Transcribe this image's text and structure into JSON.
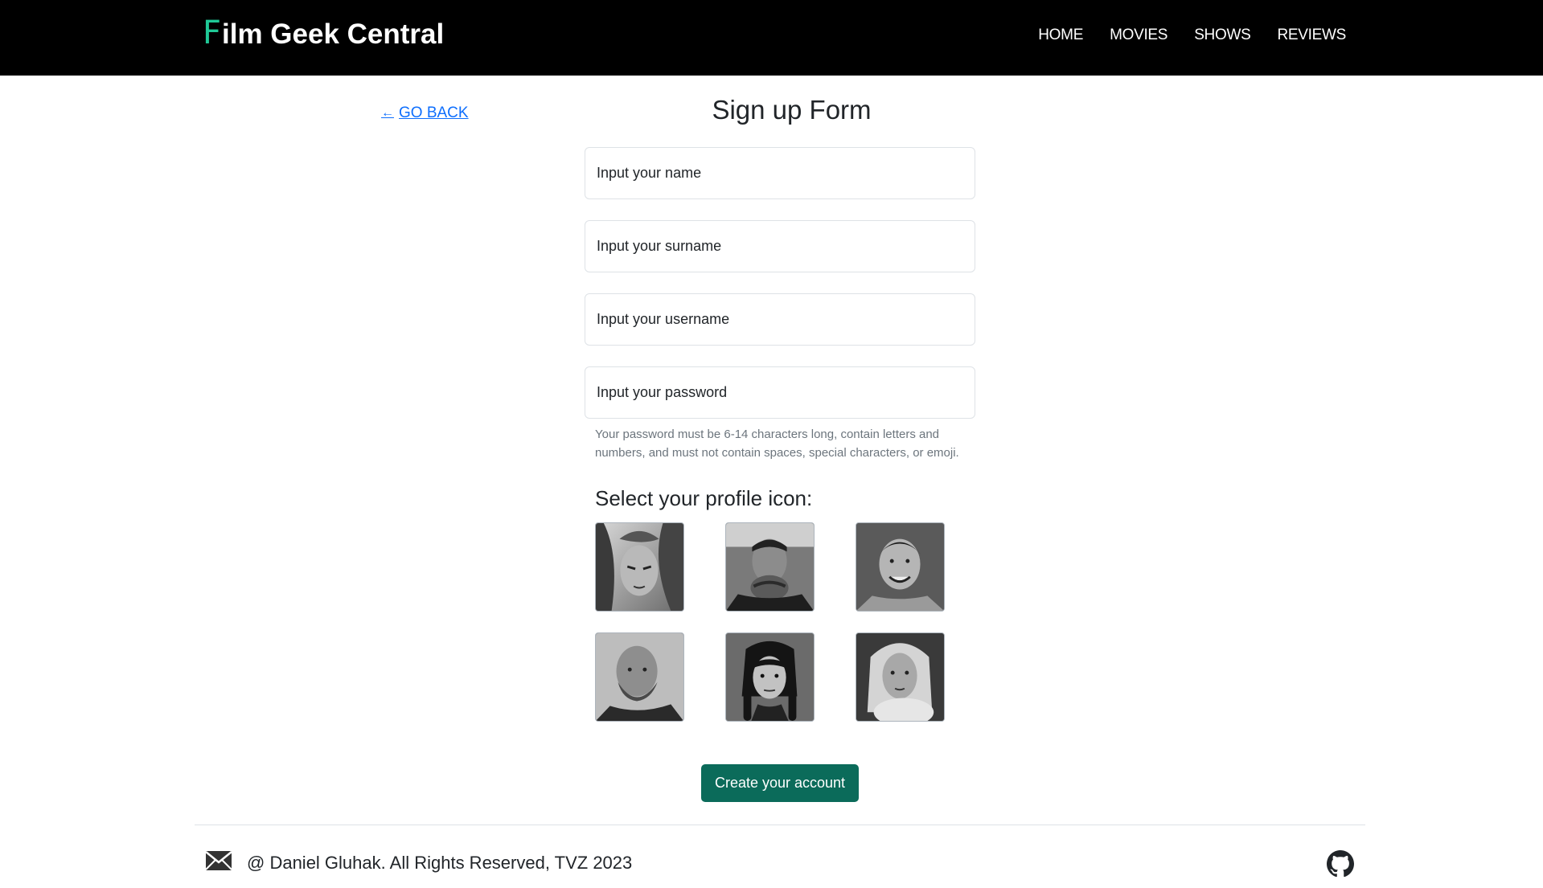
{
  "navbar": {
    "brand_first_letter": "F",
    "brand_rest": "ilm Geek Central",
    "links": [
      "HOME",
      "MOVIES",
      "SHOWS",
      "REVIEWS"
    ],
    "accent_color": "#20c997",
    "background": "#000000"
  },
  "back_link": {
    "arrow": "←",
    "label": "GO BACK"
  },
  "form": {
    "title": "Sign up Form",
    "fields": {
      "name_placeholder": "Input your name",
      "surname_placeholder": "Input your surname",
      "username_placeholder": "Input your username",
      "password_placeholder": "Input your password"
    },
    "password_hint": "Your password must be 6-14 characters long, contain letters and numbers, and must not contain spaces, special characters, or emoji.",
    "icon_heading": "Select your profile icon:",
    "profile_icons": [
      "profile-icon-animated-character",
      "profile-icon-man-hands-clasped",
      "profile-icon-smiling-man",
      "profile-icon-bearded-man",
      "profile-icon-girl-braids",
      "profile-icon-blonde-woman"
    ],
    "submit_label": "Create your account",
    "submit_color": "#0b6b5a"
  },
  "footer": {
    "mail_icon": "mail-icon",
    "copyright": "@ Daniel Gluhak. All Rights Reserved, TVZ 2023",
    "github_icon": "github-icon"
  }
}
